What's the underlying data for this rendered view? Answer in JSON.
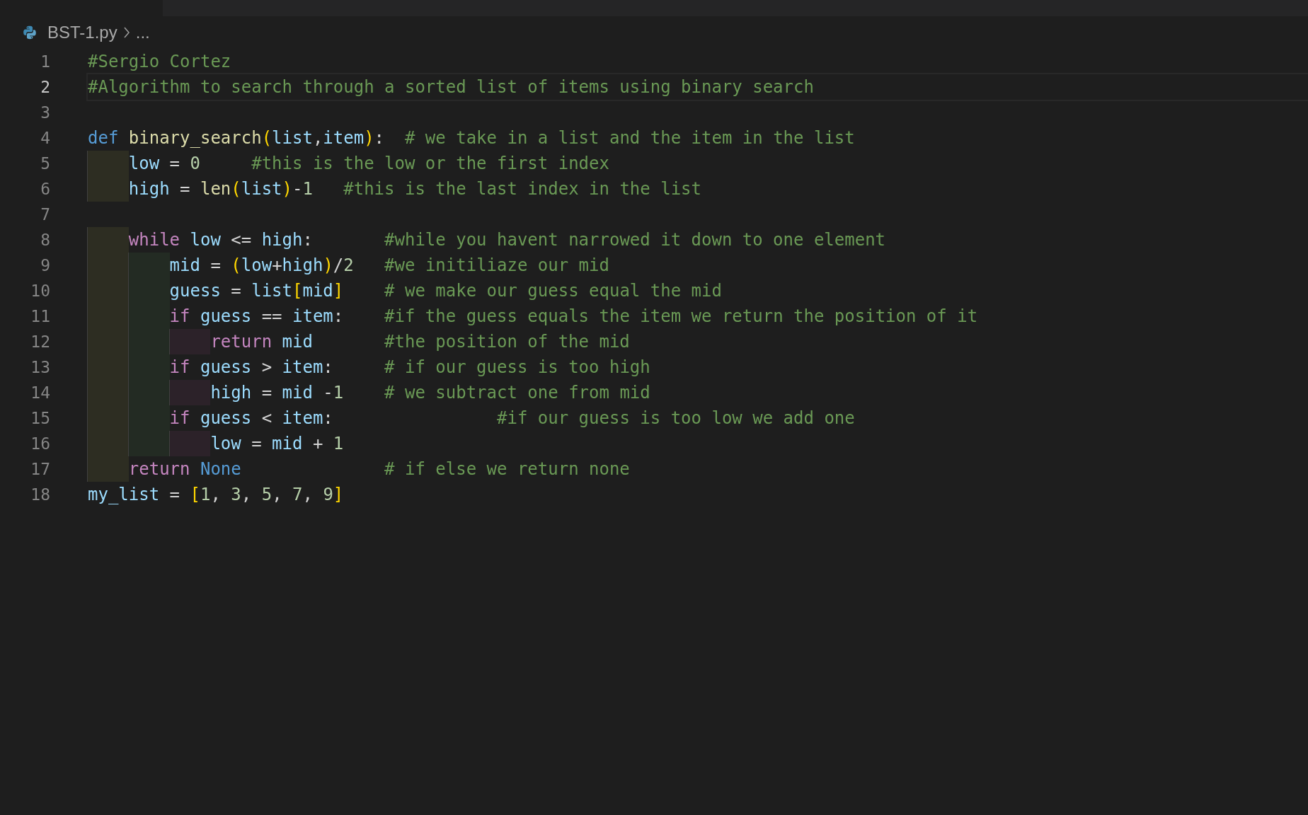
{
  "breadcrumb": {
    "file": "BST-1.py",
    "more": "..."
  },
  "lines": [
    {
      "number": "1",
      "current": false,
      "tokens": [
        {
          "kind": "comment",
          "text": "#Sergio Cortez"
        }
      ]
    },
    {
      "number": "2",
      "current": true,
      "tokens": [
        {
          "kind": "comment",
          "text": "#Algorithm to search through a sorted list of items using binary search"
        }
      ]
    },
    {
      "number": "3",
      "current": false
    },
    {
      "number": "4",
      "current": false,
      "tokens": [
        {
          "kind": "keyword",
          "text": "def"
        },
        {
          "kind": "function",
          "text": " binary_search"
        },
        {
          "kind": "bracket",
          "text": "("
        },
        {
          "kind": "variable",
          "text": "list"
        },
        {
          "kind": "op",
          "text": ","
        },
        {
          "kind": "variable",
          "text": "item"
        },
        {
          "kind": "bracket",
          "text": ")"
        },
        {
          "kind": "op",
          "text": ":"
        },
        {
          "kind": "comment",
          "text": "  # we take in a list and the item in the list"
        }
      ]
    },
    {
      "number": "5",
      "current": false,
      "tokens": [
        {
          "kind": "variable",
          "text": "    low"
        },
        {
          "kind": "op",
          "text": " ="
        },
        {
          "kind": "number",
          "text": " 0"
        },
        {
          "kind": "comment",
          "text": "     #this is the low or the first index"
        }
      ]
    },
    {
      "number": "6",
      "current": false,
      "tokens": [
        {
          "kind": "variable",
          "text": "    high"
        },
        {
          "kind": "op",
          "text": " ="
        },
        {
          "kind": "function",
          "text": " len"
        },
        {
          "kind": "bracket",
          "text": "("
        },
        {
          "kind": "variable",
          "text": "list"
        },
        {
          "kind": "bracket",
          "text": ")"
        },
        {
          "kind": "op",
          "text": "-"
        },
        {
          "kind": "number",
          "text": "1"
        },
        {
          "kind": "comment",
          "text": "   #this is the last index in the list"
        }
      ]
    },
    {
      "number": "7",
      "current": false
    },
    {
      "number": "8",
      "current": false,
      "tokens": [
        {
          "kind": "control",
          "text": "    while"
        },
        {
          "kind": "variable",
          "text": " low"
        },
        {
          "kind": "op",
          "text": " <="
        },
        {
          "kind": "variable",
          "text": " high"
        },
        {
          "kind": "op",
          "text": ":"
        },
        {
          "kind": "comment",
          "text": "       #while you havent narrowed it down to one element"
        }
      ]
    },
    {
      "number": "9",
      "current": false,
      "tokens": [
        {
          "kind": "variable",
          "text": "        mid"
        },
        {
          "kind": "op",
          "text": " ="
        },
        {
          "kind": "bracket",
          "text": " ("
        },
        {
          "kind": "variable",
          "text": "low"
        },
        {
          "kind": "op",
          "text": "+"
        },
        {
          "kind": "variable",
          "text": "high"
        },
        {
          "kind": "bracket",
          "text": ")"
        },
        {
          "kind": "op",
          "text": "/"
        },
        {
          "kind": "number",
          "text": "2"
        },
        {
          "kind": "comment",
          "text": "   #we initiliaze our mid"
        }
      ]
    },
    {
      "number": "10",
      "current": false,
      "tokens": [
        {
          "kind": "variable",
          "text": "        guess"
        },
        {
          "kind": "op",
          "text": " ="
        },
        {
          "kind": "variable",
          "text": " list"
        },
        {
          "kind": "bracket",
          "text": "["
        },
        {
          "kind": "variable",
          "text": "mid"
        },
        {
          "kind": "bracket",
          "text": "]"
        },
        {
          "kind": "comment",
          "text": "    # we make our guess equal the mid"
        }
      ]
    },
    {
      "number": "11",
      "current": false,
      "tokens": [
        {
          "kind": "control",
          "text": "        if"
        },
        {
          "kind": "variable",
          "text": " guess"
        },
        {
          "kind": "op",
          "text": " =="
        },
        {
          "kind": "variable",
          "text": " item"
        },
        {
          "kind": "op",
          "text": ":"
        },
        {
          "kind": "comment",
          "text": "    #if the guess equals the item we return the position of it"
        }
      ]
    },
    {
      "number": "12",
      "current": false,
      "tokens": [
        {
          "kind": "control",
          "text": "            return"
        },
        {
          "kind": "variable",
          "text": " mid"
        },
        {
          "kind": "comment",
          "text": "       #the position of the mid"
        }
      ]
    },
    {
      "number": "13",
      "current": false,
      "tokens": [
        {
          "kind": "control",
          "text": "        if"
        },
        {
          "kind": "variable",
          "text": " guess"
        },
        {
          "kind": "op",
          "text": " >"
        },
        {
          "kind": "variable",
          "text": " item"
        },
        {
          "kind": "op",
          "text": ":"
        },
        {
          "kind": "comment",
          "text": "     # if our guess is too high"
        }
      ]
    },
    {
      "number": "14",
      "current": false,
      "tokens": [
        {
          "kind": "variable",
          "text": "            high"
        },
        {
          "kind": "op",
          "text": " ="
        },
        {
          "kind": "variable",
          "text": " mid"
        },
        {
          "kind": "op",
          "text": " -"
        },
        {
          "kind": "number",
          "text": "1"
        },
        {
          "kind": "comment",
          "text": "    # we subtract one from mid"
        }
      ]
    },
    {
      "number": "15",
      "current": false,
      "tokens": [
        {
          "kind": "control",
          "text": "        if"
        },
        {
          "kind": "variable",
          "text": " guess"
        },
        {
          "kind": "op",
          "text": " <"
        },
        {
          "kind": "variable",
          "text": " item"
        },
        {
          "kind": "op",
          "text": ":"
        },
        {
          "kind": "comment",
          "text": "                #if our guess is too low we add one"
        }
      ]
    },
    {
      "number": "16",
      "current": false,
      "tokens": [
        {
          "kind": "variable",
          "text": "            low"
        },
        {
          "kind": "op",
          "text": " ="
        },
        {
          "kind": "variable",
          "text": " mid"
        },
        {
          "kind": "op",
          "text": " +"
        },
        {
          "kind": "number",
          "text": " 1"
        }
      ]
    },
    {
      "number": "17",
      "current": false,
      "tokens": [
        {
          "kind": "control",
          "text": "    return"
        },
        {
          "kind": "keyword",
          "text": " None"
        },
        {
          "kind": "comment",
          "text": "              # if else we return none"
        }
      ]
    },
    {
      "number": "18",
      "current": false,
      "tokens": [
        {
          "kind": "variable",
          "text": "my_list"
        },
        {
          "kind": "op",
          "text": " ="
        },
        {
          "kind": "bracket",
          "text": " ["
        },
        {
          "kind": "number",
          "text": "1"
        },
        {
          "kind": "op",
          "text": ","
        },
        {
          "kind": "number",
          "text": " 3"
        },
        {
          "kind": "op",
          "text": ","
        },
        {
          "kind": "number",
          "text": " 5"
        },
        {
          "kind": "op",
          "text": ","
        },
        {
          "kind": "number",
          "text": " 7"
        },
        {
          "kind": "op",
          "text": ","
        },
        {
          "kind": "number",
          "text": " 9"
        },
        {
          "kind": "bracket",
          "text": "]"
        }
      ]
    }
  ]
}
